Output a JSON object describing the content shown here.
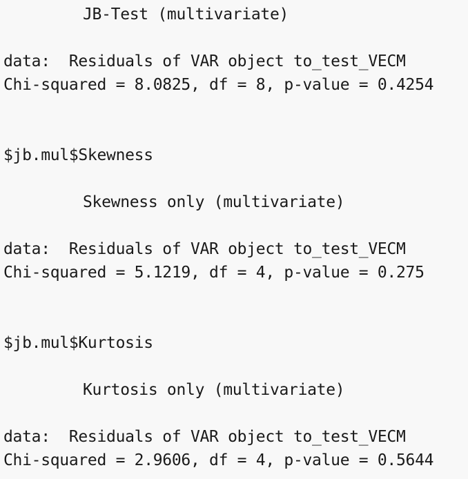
{
  "console": {
    "blocks": [
      {
        "test_title": "JB-Test (multivariate)",
        "data_line": "data:  Residuals of VAR object to_test_VECM",
        "stat_line": "Chi-squared = 8.0825, df = 8, p-value = 0.4254"
      },
      {
        "header": "$jb.mul$Skewness",
        "test_title": "Skewness only (multivariate)",
        "data_line": "data:  Residuals of VAR object to_test_VECM",
        "stat_line": "Chi-squared = 5.1219, df = 4, p-value = 0.275"
      },
      {
        "header": "$jb.mul$Kurtosis",
        "test_title": "Kurtosis only (multivariate)",
        "data_line": "data:  Residuals of VAR object to_test_VECM",
        "stat_line": "Chi-squared = 2.9606, df = 4, p-value = 0.5644"
      }
    ]
  }
}
